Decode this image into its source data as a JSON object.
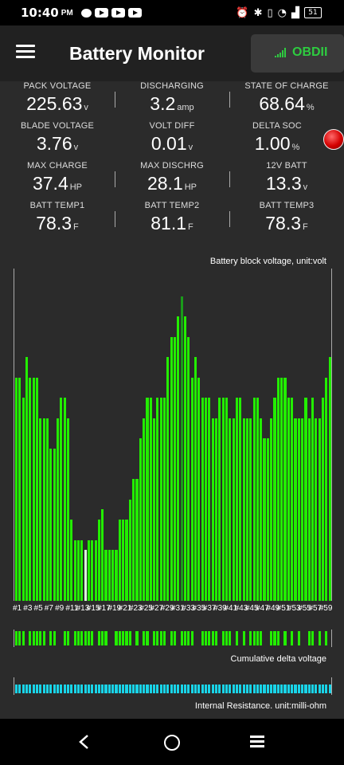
{
  "status_bar": {
    "time": "10:40",
    "ampm": "PM",
    "battery": "51"
  },
  "app_bar": {
    "title": "Battery Monitor",
    "connection_label": "OBDII",
    "connection_color": "#2ecc40"
  },
  "metrics": [
    {
      "label": "PACK VOLTAGE",
      "value": "225.63",
      "unit": "v"
    },
    {
      "label": "DISCHARGING",
      "value": "3.2",
      "unit": "amp"
    },
    {
      "label": "STATE OF CHARGE",
      "value": "68.64",
      "unit": "%"
    },
    {
      "label": "BLADE VOLTAGE",
      "value": "3.76",
      "unit": "v"
    },
    {
      "label": "VOLT DIFF",
      "value": "0.01",
      "unit": "v"
    },
    {
      "label": "DELTA SOC",
      "value": "1.00",
      "unit": "%"
    },
    {
      "label": "MAX CHARGE",
      "value": "37.4",
      "unit": "HP"
    },
    {
      "label": "MAX DISCHRG",
      "value": "28.1",
      "unit": "HP"
    },
    {
      "label": "12V BATT",
      "value": "13.3",
      "unit": "v"
    },
    {
      "label": "BATT TEMP1",
      "value": "78.3",
      "unit": "F"
    },
    {
      "label": "BATT TEMP2",
      "value": "81.1",
      "unit": "F"
    },
    {
      "label": "BATT TEMP3",
      "value": "78.3",
      "unit": "F"
    }
  ],
  "chart_data": [
    {
      "type": "bar",
      "title": "Battery block voltage, unit:volt",
      "bar_color": "#22ee00",
      "max_color": "#1a9a1a",
      "min_color": "#ddffdd",
      "max_index": 48,
      "min_index": 20,
      "tick_labels": [
        "#1",
        "#3",
        "#5",
        "#7",
        "#9",
        "#11",
        "#13",
        "#15",
        "#17",
        "#19",
        "#21",
        "#23",
        "#25",
        "#27",
        "#29",
        "#31",
        "#33",
        "#35",
        "#37",
        "#39",
        "#41",
        "#43",
        "#45",
        "#47",
        "#49",
        "#51",
        "#53",
        "#55",
        "#57",
        "#59"
      ],
      "values": [
        3.77,
        3.77,
        3.75,
        3.79,
        3.77,
        3.77,
        3.77,
        3.73,
        3.73,
        3.73,
        3.7,
        3.7,
        3.73,
        3.75,
        3.75,
        3.73,
        3.63,
        3.61,
        3.61,
        3.61,
        3.6,
        3.61,
        3.61,
        3.61,
        3.63,
        3.64,
        3.6,
        3.6,
        3.6,
        3.6,
        3.63,
        3.63,
        3.63,
        3.65,
        3.67,
        3.67,
        3.71,
        3.73,
        3.75,
        3.75,
        3.73,
        3.75,
        3.75,
        3.75,
        3.79,
        3.81,
        3.81,
        3.83,
        3.85,
        3.83,
        3.81,
        3.77,
        3.79,
        3.77,
        3.75,
        3.75,
        3.75,
        3.73,
        3.73,
        3.75,
        3.75,
        3.75,
        3.73,
        3.73,
        3.75,
        3.75,
        3.73,
        3.73,
        3.73,
        3.75,
        3.75,
        3.73,
        3.71,
        3.71,
        3.73,
        3.75,
        3.77,
        3.77,
        3.77,
        3.75,
        3.75,
        3.73,
        3.73,
        3.73,
        3.75,
        3.73,
        3.75,
        3.73,
        3.73,
        3.75,
        3.77,
        3.79
      ]
    },
    {
      "type": "bar",
      "title": "Cumulative delta voltage",
      "bar_color": "#22ee00",
      "max_color": "#1a9a1a",
      "values": [
        1,
        1,
        1,
        0,
        1,
        1,
        1,
        1,
        1,
        0,
        1,
        1,
        0,
        0,
        1,
        1,
        0,
        1,
        1,
        1,
        1,
        1,
        1,
        0,
        1,
        1,
        1,
        0,
        0,
        1,
        1,
        1,
        1,
        1,
        0,
        1,
        0,
        1,
        1,
        0,
        1,
        1,
        1,
        1,
        0,
        1,
        1,
        0,
        1,
        1,
        1,
        1,
        0,
        0,
        1,
        1,
        1,
        1,
        1,
        0,
        1,
        1,
        1,
        0,
        1,
        0,
        1,
        0,
        1,
        1,
        1,
        1,
        0,
        0,
        1,
        1,
        1,
        0,
        1,
        0,
        1,
        0,
        1,
        0,
        0,
        1,
        1,
        0,
        1,
        0,
        1,
        0
      ]
    },
    {
      "type": "bar",
      "title": "Internal Resistance. unit:milli-ohm",
      "bar_color": "#19d4e8",
      "values": [
        1,
        1,
        1,
        1,
        1,
        1,
        1,
        1,
        1,
        1,
        1,
        1,
        1,
        1,
        1,
        1,
        1,
        1,
        1,
        1,
        1,
        1,
        1,
        1,
        1,
        1,
        1,
        1,
        1,
        1,
        1,
        1,
        1,
        1,
        1,
        1,
        1,
        1,
        1,
        1,
        1,
        1,
        1,
        1,
        1,
        1,
        1,
        1,
        1,
        1,
        1,
        1,
        1,
        1,
        1,
        1,
        1,
        1,
        1,
        1,
        1,
        1,
        1,
        1,
        1,
        1,
        1,
        1,
        1,
        1,
        1,
        1,
        1,
        1,
        1,
        1,
        1,
        1,
        1,
        1,
        1,
        1,
        1,
        1,
        1,
        1,
        1,
        1,
        1,
        1,
        1,
        1
      ]
    }
  ]
}
